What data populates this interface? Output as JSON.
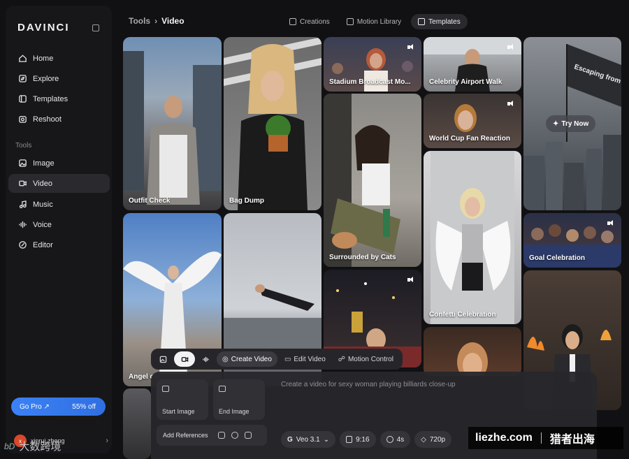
{
  "sidebar": {
    "brand": "DAVINCI",
    "items": [
      {
        "label": "Home",
        "icon": "home-icon"
      },
      {
        "label": "Explore",
        "icon": "compass-icon"
      },
      {
        "label": "Templates",
        "icon": "templates-icon"
      },
      {
        "label": "Reshoot",
        "icon": "camera-icon"
      }
    ],
    "tools_label": "Tools",
    "tools": [
      {
        "label": "Image",
        "icon": "image-icon"
      },
      {
        "label": "Video",
        "icon": "video-icon",
        "active": true
      },
      {
        "label": "Music",
        "icon": "music-icon"
      },
      {
        "label": "Voice",
        "icon": "waveform-icon"
      },
      {
        "label": "Editor",
        "icon": "editor-icon"
      }
    ],
    "gopro_label": "Go Pro ↗",
    "gopro_discount": "55% off",
    "user": {
      "initial": "x",
      "name": "xinrui zheng"
    }
  },
  "header": {
    "breadcrumb": [
      "Tools",
      "Video"
    ],
    "tabs": [
      {
        "label": "Creations",
        "active": false
      },
      {
        "label": "Motion Library",
        "active": false
      },
      {
        "label": "Templates",
        "active": true
      }
    ]
  },
  "templates": [
    {
      "caption": "Outfit Check"
    },
    {
      "caption": "Bag Dump"
    },
    {
      "caption": "Stadium Broadcast Mo..."
    },
    {
      "caption": "Celebrity Airport Walk"
    },
    {
      "caption": "World Cup Fan Reaction"
    },
    {
      "caption": "Surrounded by Cats"
    },
    {
      "caption": "Confetti Celebration"
    },
    {
      "caption": "Goal Celebration"
    },
    {
      "caption": "Angel c"
    },
    {
      "caption": "Escaping from dinosaurs"
    }
  ],
  "try_now_label": "Try Now",
  "composer": {
    "modes": [
      "Create Video",
      "Edit Video",
      "Motion Control"
    ],
    "start_image_label": "Start Image",
    "end_image_label": "End Image",
    "add_references_label": "Add References",
    "prompt_placeholder": "Create a video for sexy woman playing billiards close-up",
    "settings": {
      "model": "Veo 3.1",
      "ratio": "9:16",
      "duration": "4s",
      "resolution": "720p"
    }
  },
  "watermarks": {
    "right_a": "liezhe.com",
    "right_b": "猎者出海",
    "left_logo": "bD",
    "left_text": "大数跨境"
  },
  "colors": {
    "accent": "#3b82f6",
    "sidebar_bg": "#17171a",
    "page_bg": "#111113"
  }
}
